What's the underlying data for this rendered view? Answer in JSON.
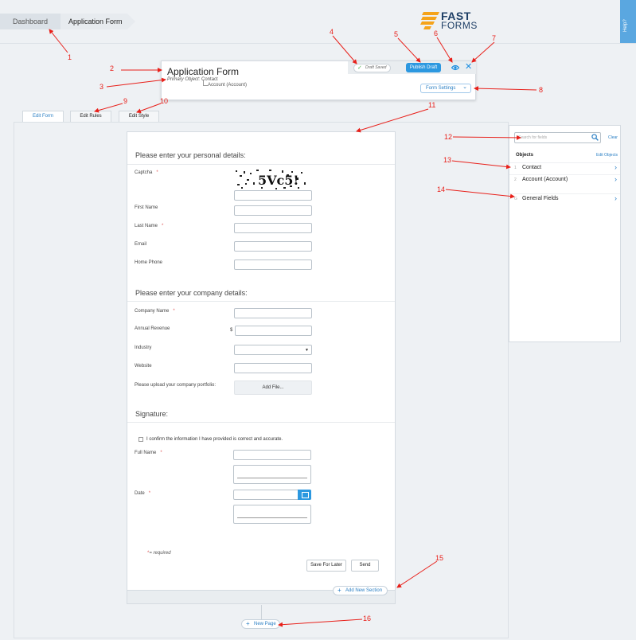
{
  "breadcrumb": {
    "items": [
      "Dashboard",
      "Application Form"
    ]
  },
  "logo": {
    "line1": "FAST",
    "line2": "FORMS"
  },
  "help_tab": {
    "label": "Help?"
  },
  "header": {
    "title": "Application Form",
    "primary_object_label": "Primary Object:",
    "primary_object_value": "Contact",
    "sub_object": "Account (Account)",
    "draft_status": "Draft Saved",
    "publish_label": "Publish Draft",
    "settings_label": "Form Settings"
  },
  "tabs": [
    "Edit Form",
    "Edit Rules",
    "Edit Style"
  ],
  "form": {
    "sections": [
      {
        "title": "Please enter your personal details:",
        "fields": [
          {
            "label": "Captcha",
            "required": true
          },
          {
            "label": "First Name",
            "required": false
          },
          {
            "label": "Last Name",
            "required": true
          },
          {
            "label": "Email",
            "required": false
          },
          {
            "label": "Home Phone",
            "required": false
          }
        ]
      },
      {
        "title": "Please enter your company details:",
        "fields": [
          {
            "label": "Company Name",
            "required": true
          },
          {
            "label": "Annual Revenue",
            "required": false
          },
          {
            "label": "Industry",
            "required": false
          },
          {
            "label": "Website",
            "required": false
          },
          {
            "label": "Please upload your company portfolio:",
            "required": false
          }
        ]
      },
      {
        "title": "Signature:",
        "fields": [
          {
            "label": "Full Name",
            "required": true
          },
          {
            "label": "Date",
            "required": true
          }
        ]
      }
    ],
    "captcha_text": "5Vc5!",
    "currency_symbol": "$",
    "add_file_label": "Add File...",
    "confirm_text": "I confirm the information I have provided is correct and accurate.",
    "required_marker": "*",
    "required_note": "required",
    "save_later_label": "Save For Later",
    "send_label": "Send",
    "add_section_label": "Add New Section",
    "new_page_label": "New Page"
  },
  "sidepanel": {
    "search_placeholder": "Search for fields",
    "clear_label": "Clear",
    "objects_label": "Objects",
    "edit_objects_label": "Edit Objects",
    "objects": [
      {
        "num": "1",
        "name": "Contact"
      },
      {
        "num": "2",
        "name": "Account (Account)"
      },
      {
        "num": "G",
        "name": "General Fields"
      }
    ]
  },
  "annotations": [
    "1",
    "2",
    "3",
    "4",
    "5",
    "6",
    "7",
    "8",
    "9",
    "10",
    "11",
    "12",
    "13",
    "14",
    "15",
    "16"
  ],
  "colors": {
    "accent": "#2c98e0",
    "annotation": "#e8201a",
    "required": "#e05a5a",
    "logo_orange": "#f5a31a",
    "logo_navy": "#1e3f66"
  }
}
